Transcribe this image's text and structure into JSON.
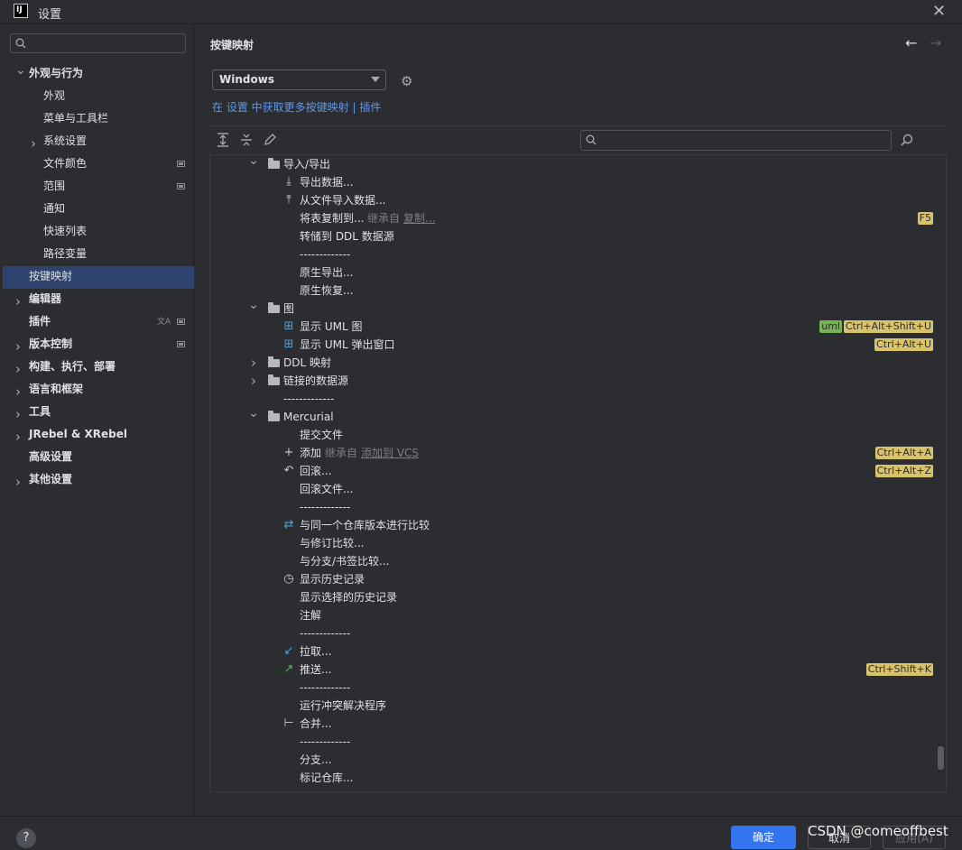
{
  "window": {
    "title": "设置",
    "app_icon": "IJ",
    "close": "✕"
  },
  "sidebar": {
    "search_placeholder": "",
    "items": [
      {
        "label": "外观与行为",
        "expanded": true
      },
      {
        "label": "外观"
      },
      {
        "label": "菜单与工具栏"
      },
      {
        "label": "系统设置"
      },
      {
        "label": "文件颜色"
      },
      {
        "label": "范围"
      },
      {
        "label": "通知"
      },
      {
        "label": "快速列表"
      },
      {
        "label": "路径变量"
      },
      {
        "label": "按键映射",
        "selected": true
      },
      {
        "label": "编辑器"
      },
      {
        "label": "插件"
      },
      {
        "label": "版本控制"
      },
      {
        "label": "构建、执行、部署"
      },
      {
        "label": "语言和框架"
      },
      {
        "label": "工具"
      },
      {
        "label": "JRebel & XRebel"
      },
      {
        "label": "高级设置"
      },
      {
        "label": "其他设置"
      }
    ]
  },
  "main": {
    "heading": "按键映射",
    "keymap_value": "Windows",
    "link_line": {
      "prefix": "在 设置 中获取更多按键映射",
      "sep": " | ",
      "plugins": "插件"
    },
    "search_placeholder": ""
  },
  "tree": [
    {
      "label": "导入/导出",
      "kind": "folder",
      "expanded": true
    },
    {
      "label": "导出数据...",
      "icon": "export-icon"
    },
    {
      "label": "从文件导入数据...",
      "icon": "import-icon"
    },
    {
      "label": "将表复制到...",
      "inherit_prefix": "继承自",
      "inherit_link": "复制...",
      "shortcuts": [
        "F5"
      ]
    },
    {
      "label": "转储到 DDL 数据源"
    },
    {
      "label": "-------------"
    },
    {
      "label": "原生导出..."
    },
    {
      "label": "原生恢复..."
    },
    {
      "label": "图",
      "kind": "folder",
      "expanded": true
    },
    {
      "label": "显示 UML 图",
      "icon": "uml-icon",
      "shortcuts_green": [
        "uml"
      ],
      "shortcuts": [
        "Ctrl+Alt+Shift+U"
      ]
    },
    {
      "label": "显示 UML 弹出窗口",
      "icon": "uml-icon",
      "shortcuts": [
        "Ctrl+Alt+U"
      ]
    },
    {
      "label": "DDL 映射",
      "kind": "folder",
      "expanded": false
    },
    {
      "label": "链接的数据源",
      "kind": "folder",
      "expanded": false
    },
    {
      "label": "-------------"
    },
    {
      "label": "Mercurial",
      "kind": "folder",
      "expanded": true
    },
    {
      "label": "提交文件"
    },
    {
      "label": "添加",
      "icon": "plus-icon",
      "inherit_prefix": "继承自",
      "inherit_link": "添加到 VCS",
      "shortcuts": [
        "Ctrl+Alt+A"
      ]
    },
    {
      "label": "回滚...",
      "icon": "undo-icon",
      "shortcuts": [
        "Ctrl+Alt+Z"
      ]
    },
    {
      "label": "回滚文件..."
    },
    {
      "label": "-------------"
    },
    {
      "label": "与同一个仓库版本进行比较",
      "icon": "diff-icon"
    },
    {
      "label": "与修订比较..."
    },
    {
      "label": "与分支/书签比较..."
    },
    {
      "label": "显示历史记录",
      "icon": "history-icon"
    },
    {
      "label": "显示选择的历史记录"
    },
    {
      "label": "注解"
    },
    {
      "label": "-------------"
    },
    {
      "label": "拉取...",
      "icon": "pull-icon"
    },
    {
      "label": "推送...",
      "icon": "push-icon",
      "shortcuts": [
        "Ctrl+Shift+K"
      ]
    },
    {
      "label": "-------------"
    },
    {
      "label": "运行冲突解决程序"
    },
    {
      "label": "合并...",
      "icon": "merge-icon"
    },
    {
      "label": "-------------"
    },
    {
      "label": "分支..."
    },
    {
      "label": "标记仓库..."
    }
  ],
  "footer": {
    "help": "?",
    "ok": "确定",
    "cancel": "取消",
    "apply": "应用(A)",
    "watermark": "CSDN @comeoffbest"
  }
}
